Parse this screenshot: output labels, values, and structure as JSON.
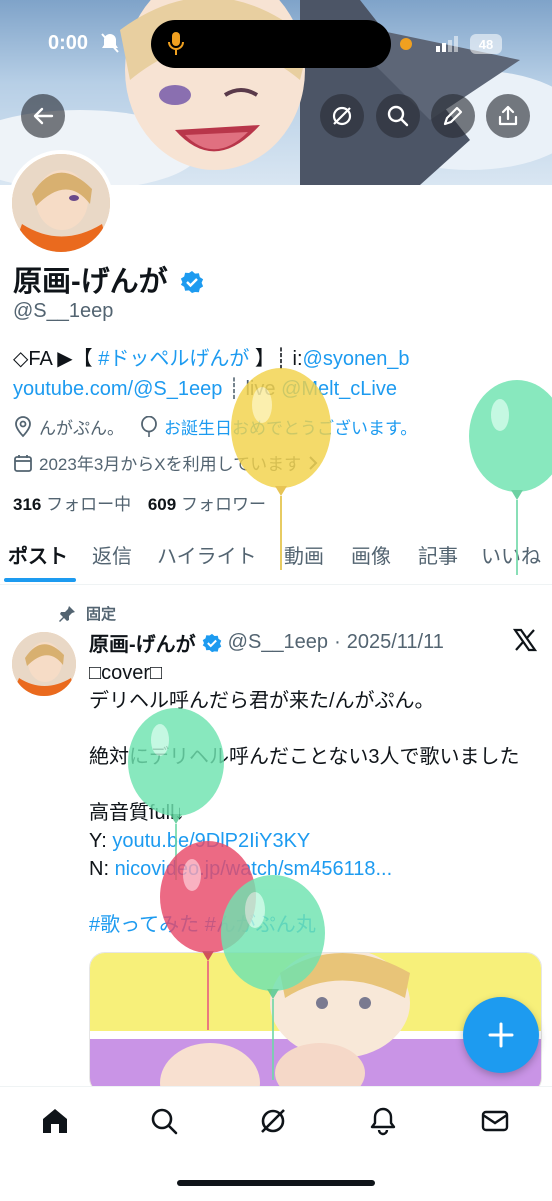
{
  "status_bar": {
    "time": "0:00",
    "battery": "48"
  },
  "profile": {
    "display_name": "原画-げんが",
    "handle": "@S__1eep",
    "bio_line1_prefix": "◇FA ▶【 ",
    "bio_hashtag": "#ドッペルげんが",
    "bio_line1_mid": " 】┊ i:",
    "bio_mention1": "@syonen_b",
    "bio_link": "youtube.com/@S_1eep",
    "bio_line2_mid": " ┊ live ",
    "bio_mention2": "@Melt_cLive",
    "location": "んがぷん。",
    "birthday": "お誕生日おめでとうございます。",
    "joined": "2023年3月からXを利用しています",
    "following_count": "316",
    "following_label": "フォロー中",
    "followers_count": "609",
    "followers_label": "フォロワー"
  },
  "tabs": [
    "ポスト",
    "返信",
    "ハイライト",
    "動画",
    "画像",
    "記事",
    "いいね"
  ],
  "pinned_post": {
    "pinned_label": "固定",
    "author_name": "原画-げんが",
    "author_handle": "@S__1eep",
    "separator": "·",
    "date": "2025/11/11",
    "line1": "□cover□",
    "line2": "デリヘル呼んだら君が来た/んがぷん。",
    "line3": "絶対にデリヘル呼んだことない3人で歌いました",
    "line4": "高音質full↓",
    "y_label": "Y: ",
    "y_link": "youtu.be/9DlP2IiY3KY",
    "n_label": "N: ",
    "n_link": "nicovideo.jp/watch/sm456118...",
    "hashtag1": "#歌ってみた",
    "hashtag2": "#んがぷん丸"
  },
  "colors": {
    "accent": "#1d9bf0",
    "text_primary": "#0f1419",
    "text_secondary": "#536471",
    "balloon_yellow": "#f2d24a",
    "balloon_green": "#6fe3b0",
    "balloon_red": "#e84a6a"
  },
  "icons": {
    "header": [
      "back-arrow-icon",
      "grok-icon",
      "search-icon",
      "edit-icon",
      "share-icon"
    ],
    "bottom_nav": [
      "home-icon",
      "search-icon",
      "grok-icon",
      "bell-icon",
      "mail-icon"
    ]
  }
}
